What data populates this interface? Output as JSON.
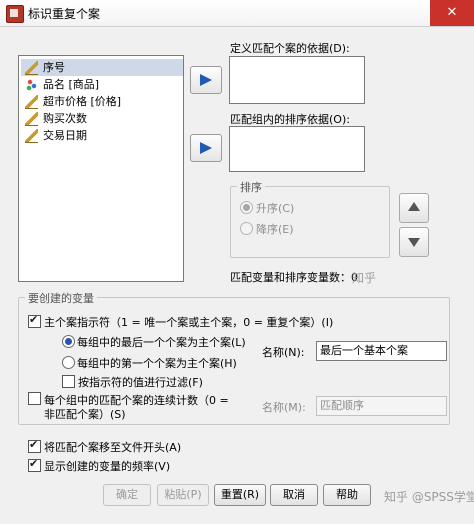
{
  "window": {
    "title": "标识重复个案",
    "close_glyph": "✕"
  },
  "variables": {
    "items": [
      {
        "label": "序号",
        "icon": "scale-ruler-icon",
        "selected": true
      },
      {
        "label": "品名 [商品]",
        "icon": "nominal-icon",
        "selected": false
      },
      {
        "label": "超市价格 [价格]",
        "icon": "scale-ruler-icon",
        "selected": false
      },
      {
        "label": "购买次数",
        "icon": "scale-ruler-icon",
        "selected": false
      },
      {
        "label": "交易日期",
        "icon": "scale-ruler-icon",
        "selected": false
      }
    ]
  },
  "match": {
    "define_label": "定义匹配个案的依据(D):",
    "sort_label": "匹配组内的排序依据(O):",
    "sort_group_title": "排序",
    "ascending_label": "升序(C)",
    "descending_label": "降序(E)",
    "count_label": "匹配变量和排序变量数：",
    "count_value": "0"
  },
  "create_vars": {
    "group_title": "要创建的变量",
    "primary_indicator_label": "主个案指示符（1 = 唯一个案或主个案，0 = 重复个案）(I)",
    "last_case_label": "每组中的最后一个个案为主个案(L)",
    "first_case_label": "每组中的第一个个案为主个案(H)",
    "filter_label": "按指示符的值进行过滤(F)",
    "name_label_1": "名称(N):",
    "name_value_1": "最后一个基本个案",
    "sequential_label_line1": "每个组中的匹配个案的连续计数（0 =",
    "sequential_label_line2": "非匹配个案）(S)",
    "name_label_2": "名称(M):",
    "name_value_2": "匹配顺序"
  },
  "options": {
    "move_to_top_label": "将匹配个案移至文件开头(A)",
    "show_freq_label": "显示创建的变量的频率(V)"
  },
  "buttons": {
    "ok": "确定",
    "paste": "粘贴(P)",
    "reset": "重置(R)",
    "cancel": "取消",
    "help": "帮助"
  },
  "watermark": {
    "top": "知乎",
    "bottom": "知乎 @SPSS学堂"
  },
  "colors": {
    "accent_blue": "#1f5bb5",
    "selection": "#cfd8e6",
    "close_red": "#c8322a"
  }
}
